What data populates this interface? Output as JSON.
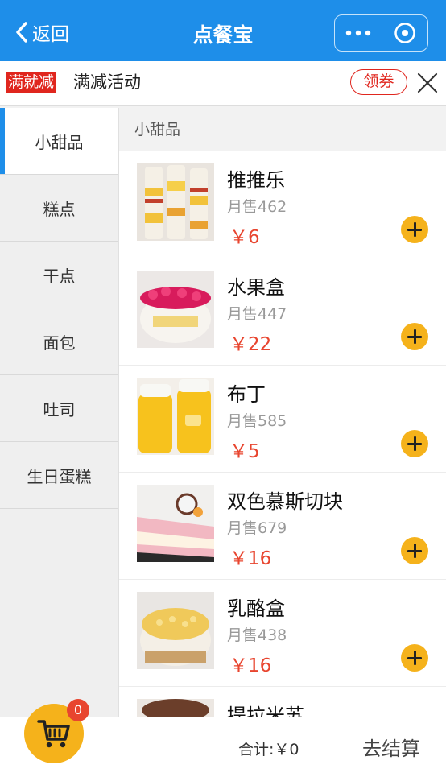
{
  "navbar": {
    "back_label": "返回",
    "title": "点餐宝"
  },
  "promo": {
    "badge": "满就减",
    "text": "满减活动",
    "coupon_label": "领券"
  },
  "sidebar": {
    "categories": [
      {
        "label": "小甜品"
      },
      {
        "label": "糕点"
      },
      {
        "label": "干点"
      },
      {
        "label": "面包"
      },
      {
        "label": "吐司"
      },
      {
        "label": "生日蛋糕"
      }
    ]
  },
  "section": {
    "title": "小甜品"
  },
  "items": [
    {
      "name": "推推乐",
      "sales": "月售462",
      "price": "￥6"
    },
    {
      "name": "水果盒",
      "sales": "月售447",
      "price": "￥22"
    },
    {
      "name": "布丁",
      "sales": "月售585",
      "price": "￥5"
    },
    {
      "name": "双色慕斯切块",
      "sales": "月售679",
      "price": "￥16"
    },
    {
      "name": "乳酪盒",
      "sales": "月售438",
      "price": "￥16"
    },
    {
      "name": "提拉米苏",
      "sales": "",
      "price": ""
    }
  ],
  "cart": {
    "count": "0",
    "total": "合计:￥0",
    "checkout_label": "去结算"
  },
  "colors": {
    "primary": "#1e8ee9",
    "accent": "#f5b21b",
    "price": "#e8452f",
    "promo_red": "#e0261e"
  }
}
